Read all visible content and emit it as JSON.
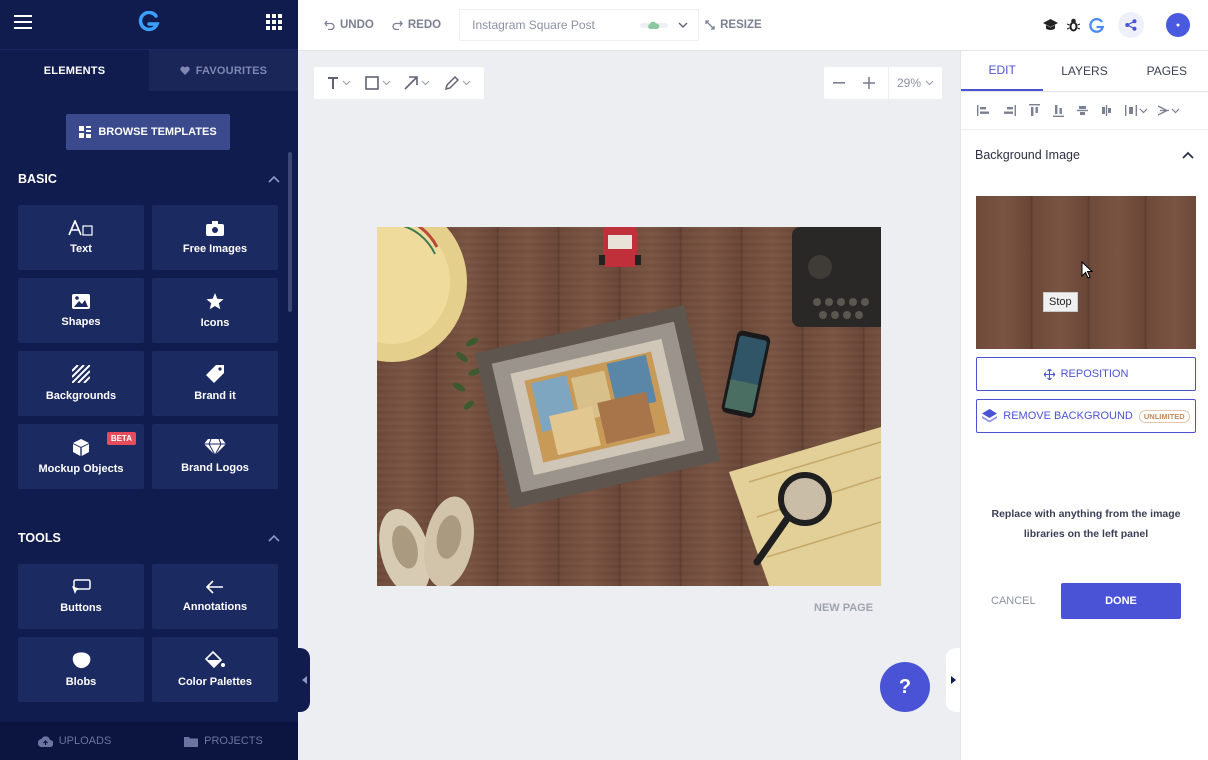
{
  "sidebar": {
    "tabs": {
      "elements": "ELEMENTS",
      "favourites": "FAVOURITES"
    },
    "browse_templates": "BROWSE TEMPLATES",
    "basic": {
      "title": "BASIC",
      "items": [
        {
          "label": "Text",
          "icon": "text-icon"
        },
        {
          "label": "Free Images",
          "icon": "camera-icon"
        },
        {
          "label": "Shapes",
          "icon": "image-shape-icon"
        },
        {
          "label": "Icons",
          "icon": "star-icon"
        },
        {
          "label": "Backgrounds",
          "icon": "stripes-icon"
        },
        {
          "label": "Brand it",
          "icon": "tag-icon"
        },
        {
          "label": "Mockup Objects",
          "icon": "cube-icon",
          "badge": "BETA"
        },
        {
          "label": "Brand Logos",
          "icon": "diamond-icon"
        }
      ]
    },
    "tools": {
      "title": "TOOLS",
      "items": [
        {
          "label": "Buttons",
          "icon": "cursor-button-icon"
        },
        {
          "label": "Annotations",
          "icon": "arrow-left-icon"
        },
        {
          "label": "Blobs",
          "icon": "blob-icon"
        },
        {
          "label": "Color Palettes",
          "icon": "paint-bucket-icon"
        }
      ]
    },
    "bottom": {
      "uploads": "UPLOADS",
      "projects": "PROJECTS"
    }
  },
  "topbar": {
    "undo": "UNDO",
    "redo": "REDO",
    "document_title": "Instagram Square Post",
    "resize": "RESIZE"
  },
  "canvas": {
    "zoom": "29%",
    "new_page": "NEW PAGE",
    "help": "?"
  },
  "right_panel": {
    "tabs": {
      "edit": "EDIT",
      "layers": "LAYERS",
      "pages": "PAGES"
    },
    "section_title": "Background Image",
    "tooltip": "Stop",
    "reposition": "REPOSITION",
    "remove_background": "REMOVE BACKGROUND",
    "unlimited_badge": "UNLIMITED",
    "hint": "Replace with anything from the image libraries on the left panel",
    "cancel": "CANCEL",
    "done": "DONE"
  },
  "colors": {
    "sidebar_bg": "#111c4e",
    "tile_bg": "#1c2a62",
    "accent": "#4a53d6",
    "beta": "#e74c5c"
  }
}
